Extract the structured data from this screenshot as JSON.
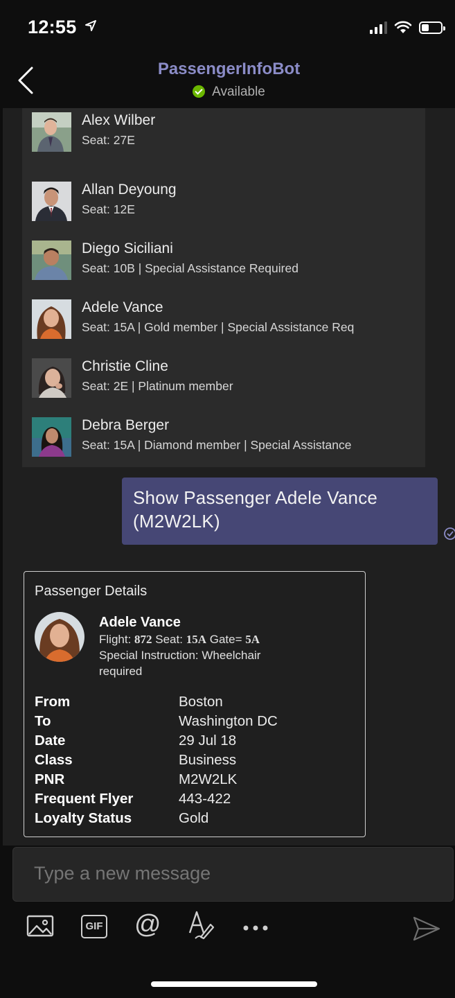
{
  "status_bar": {
    "time": "12:55"
  },
  "header": {
    "title": "PassengerInfoBot",
    "status": "Available"
  },
  "passenger_list": [
    {
      "name": "Alex Wilber",
      "detail": "Seat: 27E",
      "avatar_color": "#5a6e5a"
    },
    {
      "name": "Allan Deyoung",
      "detail": "Seat: 12E",
      "avatar_color": "#6c6f78"
    },
    {
      "name": "Diego Siciliani",
      "detail": "Seat: 10B | Special Assistance Required",
      "avatar_color": "#7a6650"
    },
    {
      "name": "Adele Vance",
      "detail": "Seat: 15A | Gold member | Special Assistance Req",
      "avatar_color": "#a06a4a"
    },
    {
      "name": "Christie Cline",
      "detail": "Seat: 2E | Platinum member",
      "avatar_color": "#7e6a5e"
    },
    {
      "name": "Debra Berger",
      "detail": "Seat: 15A | Diamond member | Special Assistance",
      "avatar_color": "#2d7f7a"
    }
  ],
  "sent_message": {
    "line1": "Show Passenger Adele Vance",
    "line2": "(M2W2LK)"
  },
  "details_card": {
    "title": "Passenger Details",
    "name": "Adele Vance",
    "flight_label": "Flight:",
    "flight_value": "872",
    "seat_label": "Seat:",
    "seat_value": "15A",
    "gate_label": "Gate=",
    "gate_value": "5A",
    "instruction_line1": "Special Instruction: Wheelchair",
    "instruction_line2": "required",
    "facts": [
      {
        "key": "From",
        "value": "Boston"
      },
      {
        "key": "To",
        "value": "Washington DC"
      },
      {
        "key": "Date",
        "value": "29 Jul 18"
      },
      {
        "key": "Class",
        "value": "Business"
      },
      {
        "key": "PNR",
        "value": "M2W2LK"
      },
      {
        "key": "Frequent Flyer",
        "value": "443-422"
      },
      {
        "key": "Loyalty Status",
        "value": "Gold"
      }
    ]
  },
  "composer": {
    "placeholder": "Type a new message"
  },
  "toolbar": {
    "gif_label": "GIF",
    "mention_label": "@"
  },
  "colors": {
    "accent": "#8b8cc7",
    "bubble": "#464775",
    "available": "#6bb700"
  }
}
